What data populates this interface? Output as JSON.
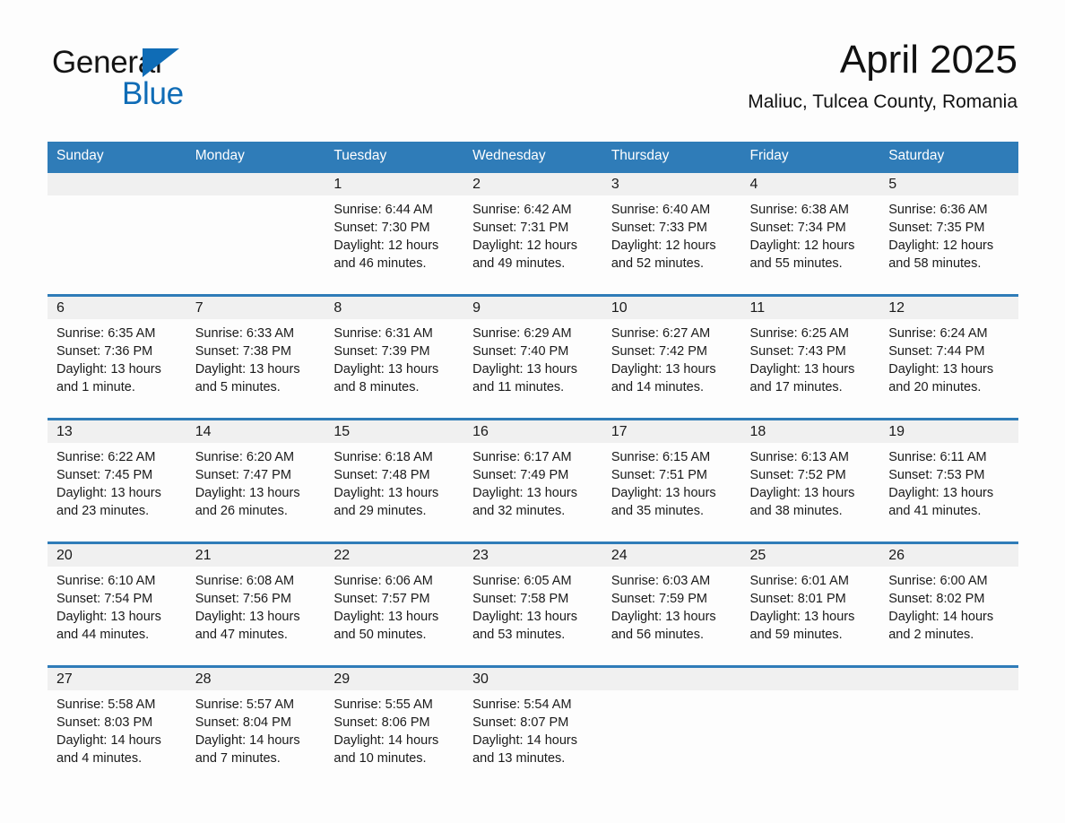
{
  "brand": {
    "name_dark": "General",
    "name_light": "Blue",
    "accent_color": "#0f6cb6",
    "logo_icon": "triangle-icon"
  },
  "header": {
    "month_title": "April 2025",
    "location": "Maliuc, Tulcea County, Romania"
  },
  "calendar": {
    "header_background": "#2f7cb8",
    "header_text_color": "#ffffff",
    "daynum_band_color": "#f0f0f0",
    "weekday_headers": [
      "Sunday",
      "Monday",
      "Tuesday",
      "Wednesday",
      "Thursday",
      "Friday",
      "Saturday"
    ],
    "weeks": [
      [
        {
          "day": "",
          "lines": []
        },
        {
          "day": "",
          "lines": []
        },
        {
          "day": "1",
          "lines": [
            "Sunrise: 6:44 AM",
            "Sunset: 7:30 PM",
            "Daylight: 12 hours",
            "and 46 minutes."
          ]
        },
        {
          "day": "2",
          "lines": [
            "Sunrise: 6:42 AM",
            "Sunset: 7:31 PM",
            "Daylight: 12 hours",
            "and 49 minutes."
          ]
        },
        {
          "day": "3",
          "lines": [
            "Sunrise: 6:40 AM",
            "Sunset: 7:33 PM",
            "Daylight: 12 hours",
            "and 52 minutes."
          ]
        },
        {
          "day": "4",
          "lines": [
            "Sunrise: 6:38 AM",
            "Sunset: 7:34 PM",
            "Daylight: 12 hours",
            "and 55 minutes."
          ]
        },
        {
          "day": "5",
          "lines": [
            "Sunrise: 6:36 AM",
            "Sunset: 7:35 PM",
            "Daylight: 12 hours",
            "and 58 minutes."
          ]
        }
      ],
      [
        {
          "day": "6",
          "lines": [
            "Sunrise: 6:35 AM",
            "Sunset: 7:36 PM",
            "Daylight: 13 hours",
            "and 1 minute."
          ]
        },
        {
          "day": "7",
          "lines": [
            "Sunrise: 6:33 AM",
            "Sunset: 7:38 PM",
            "Daylight: 13 hours",
            "and 5 minutes."
          ]
        },
        {
          "day": "8",
          "lines": [
            "Sunrise: 6:31 AM",
            "Sunset: 7:39 PM",
            "Daylight: 13 hours",
            "and 8 minutes."
          ]
        },
        {
          "day": "9",
          "lines": [
            "Sunrise: 6:29 AM",
            "Sunset: 7:40 PM",
            "Daylight: 13 hours",
            "and 11 minutes."
          ]
        },
        {
          "day": "10",
          "lines": [
            "Sunrise: 6:27 AM",
            "Sunset: 7:42 PM",
            "Daylight: 13 hours",
            "and 14 minutes."
          ]
        },
        {
          "day": "11",
          "lines": [
            "Sunrise: 6:25 AM",
            "Sunset: 7:43 PM",
            "Daylight: 13 hours",
            "and 17 minutes."
          ]
        },
        {
          "day": "12",
          "lines": [
            "Sunrise: 6:24 AM",
            "Sunset: 7:44 PM",
            "Daylight: 13 hours",
            "and 20 minutes."
          ]
        }
      ],
      [
        {
          "day": "13",
          "lines": [
            "Sunrise: 6:22 AM",
            "Sunset: 7:45 PM",
            "Daylight: 13 hours",
            "and 23 minutes."
          ]
        },
        {
          "day": "14",
          "lines": [
            "Sunrise: 6:20 AM",
            "Sunset: 7:47 PM",
            "Daylight: 13 hours",
            "and 26 minutes."
          ]
        },
        {
          "day": "15",
          "lines": [
            "Sunrise: 6:18 AM",
            "Sunset: 7:48 PM",
            "Daylight: 13 hours",
            "and 29 minutes."
          ]
        },
        {
          "day": "16",
          "lines": [
            "Sunrise: 6:17 AM",
            "Sunset: 7:49 PM",
            "Daylight: 13 hours",
            "and 32 minutes."
          ]
        },
        {
          "day": "17",
          "lines": [
            "Sunrise: 6:15 AM",
            "Sunset: 7:51 PM",
            "Daylight: 13 hours",
            "and 35 minutes."
          ]
        },
        {
          "day": "18",
          "lines": [
            "Sunrise: 6:13 AM",
            "Sunset: 7:52 PM",
            "Daylight: 13 hours",
            "and 38 minutes."
          ]
        },
        {
          "day": "19",
          "lines": [
            "Sunrise: 6:11 AM",
            "Sunset: 7:53 PM",
            "Daylight: 13 hours",
            "and 41 minutes."
          ]
        }
      ],
      [
        {
          "day": "20",
          "lines": [
            "Sunrise: 6:10 AM",
            "Sunset: 7:54 PM",
            "Daylight: 13 hours",
            "and 44 minutes."
          ]
        },
        {
          "day": "21",
          "lines": [
            "Sunrise: 6:08 AM",
            "Sunset: 7:56 PM",
            "Daylight: 13 hours",
            "and 47 minutes."
          ]
        },
        {
          "day": "22",
          "lines": [
            "Sunrise: 6:06 AM",
            "Sunset: 7:57 PM",
            "Daylight: 13 hours",
            "and 50 minutes."
          ]
        },
        {
          "day": "23",
          "lines": [
            "Sunrise: 6:05 AM",
            "Sunset: 7:58 PM",
            "Daylight: 13 hours",
            "and 53 minutes."
          ]
        },
        {
          "day": "24",
          "lines": [
            "Sunrise: 6:03 AM",
            "Sunset: 7:59 PM",
            "Daylight: 13 hours",
            "and 56 minutes."
          ]
        },
        {
          "day": "25",
          "lines": [
            "Sunrise: 6:01 AM",
            "Sunset: 8:01 PM",
            "Daylight: 13 hours",
            "and 59 minutes."
          ]
        },
        {
          "day": "26",
          "lines": [
            "Sunrise: 6:00 AM",
            "Sunset: 8:02 PM",
            "Daylight: 14 hours",
            "and 2 minutes."
          ]
        }
      ],
      [
        {
          "day": "27",
          "lines": [
            "Sunrise: 5:58 AM",
            "Sunset: 8:03 PM",
            "Daylight: 14 hours",
            "and 4 minutes."
          ]
        },
        {
          "day": "28",
          "lines": [
            "Sunrise: 5:57 AM",
            "Sunset: 8:04 PM",
            "Daylight: 14 hours",
            "and 7 minutes."
          ]
        },
        {
          "day": "29",
          "lines": [
            "Sunrise: 5:55 AM",
            "Sunset: 8:06 PM",
            "Daylight: 14 hours",
            "and 10 minutes."
          ]
        },
        {
          "day": "30",
          "lines": [
            "Sunrise: 5:54 AM",
            "Sunset: 8:07 PM",
            "Daylight: 14 hours",
            "and 13 minutes."
          ]
        },
        {
          "day": "",
          "lines": []
        },
        {
          "day": "",
          "lines": []
        },
        {
          "day": "",
          "lines": []
        }
      ]
    ]
  }
}
